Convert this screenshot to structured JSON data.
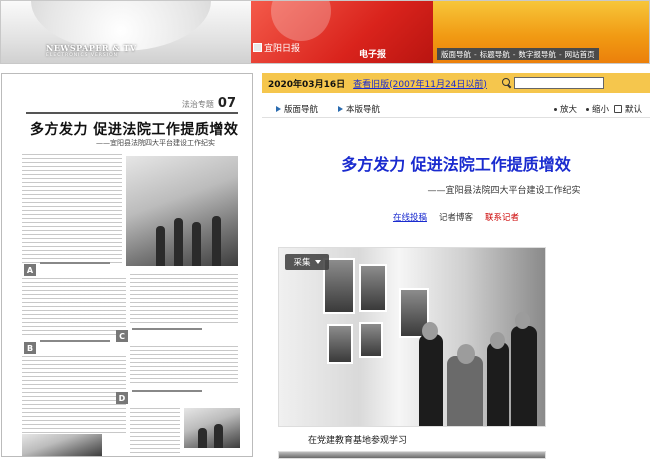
{
  "header": {
    "brand_line1": "NEWSPAPER & TV",
    "brand_line2": "ELECTRONICS VERSION",
    "logo_alt": "宜阳日报",
    "epaper_label": "电子报",
    "nav": [
      "版面导航",
      "标题导航",
      "数字报导航",
      "网站首页"
    ],
    "nav_separator": "-"
  },
  "page_preview": {
    "page_label": "法治专题",
    "page_number": "07",
    "headline": "多方发力 促进法院工作提质增效",
    "subheadline": "——宜阳县法院四大平台建设工作纪实",
    "section_badges": [
      "A",
      "B",
      "C",
      "D"
    ]
  },
  "article_view": {
    "date": "2020年03月16日",
    "history_link": "查看旧版(2007年11月24日以前)",
    "search_placeholder": "",
    "toolbar": {
      "page_nav": "版面导航",
      "this_page_nav": "本版导航",
      "zoom_in": "放大",
      "zoom_out": "缩小",
      "default": "默认"
    },
    "title": "多方发力 促进法院工作提质增效",
    "subtitle": "——宜阳县法院四大平台建设工作纪实",
    "links": {
      "contribute": "在线投稿",
      "reporter_blog": "记者博客",
      "contact_reporter": "联系记者"
    },
    "collect_button": "采集",
    "photo_caption": "在党建教育基地参观学习"
  },
  "colors": {
    "accent_blue": "#1a2bcf",
    "datebar": "#f5c64d",
    "header_red": "#d9231c",
    "header_orange": "#f19a13",
    "contact_red": "#cc0000"
  }
}
